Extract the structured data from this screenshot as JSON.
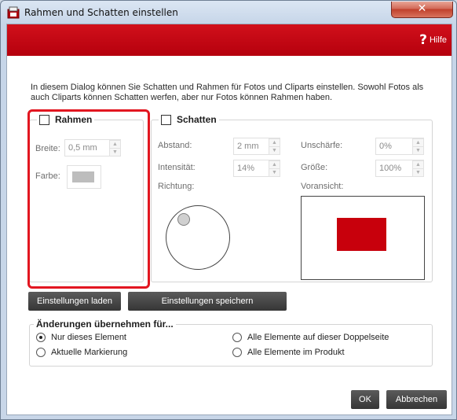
{
  "window": {
    "title": "Rahmen und Schatten einstellen",
    "close_label": "✕",
    "icon": "app-icon"
  },
  "header": {
    "help_icon": "?",
    "help_label": "Hilfe"
  },
  "intro": "In diesem Dialog können Sie Schatten und Rahmen für Fotos und Cliparts einstellen. Sowohl Fotos als auch Cliparts können Schatten werfen, aber nur Fotos können Rahmen haben.",
  "frame": {
    "title": "Rahmen",
    "checked": false,
    "width_label": "Breite:",
    "width_value": "0,5 mm",
    "color_label": "Farbe:",
    "swatch_color": "#bdbdbd"
  },
  "shadow": {
    "title": "Schatten",
    "checked": false,
    "distance_label": "Abstand:",
    "distance_value": "2 mm",
    "intensity_label": "Intensität:",
    "intensity_value": "14%",
    "blur_label": "Unschärfe:",
    "blur_value": "0%",
    "size_label": "Größe:",
    "size_value": "100%",
    "direction_label": "Richtung:",
    "preview_label": "Voransicht:",
    "preview_color": "#c8000c"
  },
  "buttons": {
    "load": "Einstellungen laden",
    "save": "Einstellungen speichern",
    "ok": "OK",
    "cancel": "Abbrechen"
  },
  "apply": {
    "title": "Änderungen übernehmen für...",
    "options": [
      {
        "label": "Nur dieses Element",
        "selected": true
      },
      {
        "label": "Aktuelle Markierung",
        "selected": false
      },
      {
        "label": "Alle Elemente auf dieser Doppelseite",
        "selected": false
      },
      {
        "label": "Alle Elemente im Produkt",
        "selected": false
      }
    ]
  },
  "colors": {
    "accent": "#c8000c",
    "highlight": "#e21620"
  }
}
